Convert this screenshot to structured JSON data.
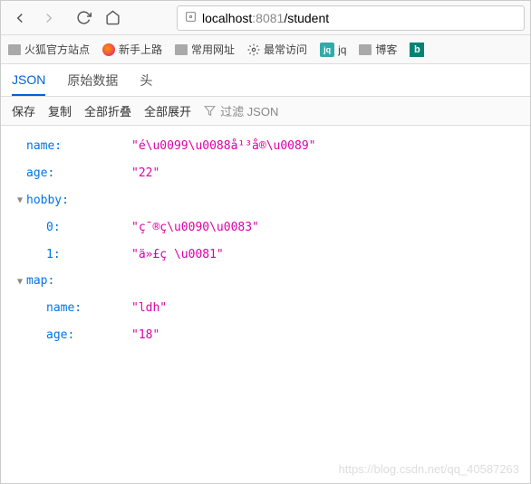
{
  "nav": {
    "url_host": "localhost",
    "url_port": ":8081",
    "url_path": "/student"
  },
  "bookmarks": {
    "b0": "火狐官方站点",
    "b1": "新手上路",
    "b2": "常用网址",
    "b3": "最常访问",
    "b4": "jq",
    "b5": "博客",
    "jq_badge": "jq"
  },
  "tabs": {
    "json": "JSON",
    "raw": "原始数据",
    "headers": "头"
  },
  "toolbar": {
    "save": "保存",
    "copy": "复制",
    "collapse": "全部折叠",
    "expand": "全部展开",
    "filter_placeholder": "过滤 JSON"
  },
  "json": {
    "k_name": "name:",
    "v_name": "\"é\\u0099\\u0088å¹³å®\\u0089\"",
    "k_age": "age:",
    "v_age": "\"22\"",
    "k_hobby": "hobby:",
    "k_0": "0:",
    "v_0": "\"ç¯®ç\\u0090\\u0083\"",
    "k_1": "1:",
    "v_1": "\"ä»£ç \\u0081\"",
    "k_map": "map:",
    "k_mname": "name:",
    "v_mname": "\"ldh\"",
    "k_mage": "age:",
    "v_mage": "\"18\""
  },
  "watermark": "https://blog.csdn.net/qq_40587263"
}
